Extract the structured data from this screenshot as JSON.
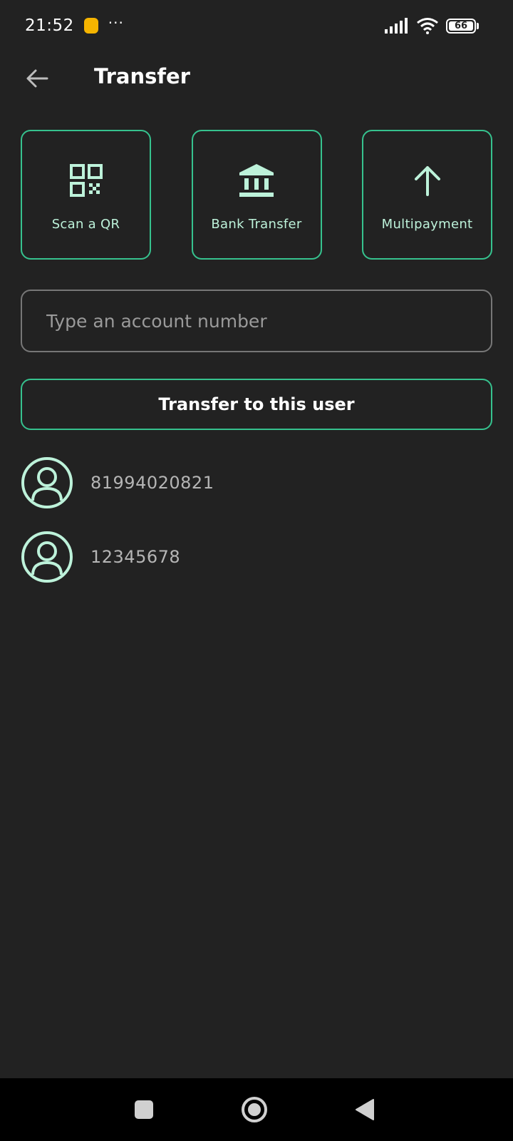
{
  "status_bar": {
    "time": "21:52",
    "battery": "66",
    "icons": [
      "notification-icon",
      "more-dots-icon",
      "signal-icon",
      "wifi-icon",
      "battery-icon"
    ]
  },
  "header": {
    "title": "Transfer",
    "back_icon": "arrow-left-icon"
  },
  "actions": [
    {
      "label": "Scan a QR",
      "icon": "qr-code-icon"
    },
    {
      "label": "Bank Transfer",
      "icon": "bank-icon"
    },
    {
      "label": "Multipayment",
      "icon": "arrow-up-icon"
    }
  ],
  "account_input": {
    "placeholder": "Type an account number",
    "value": ""
  },
  "transfer_button": {
    "label": "Transfer to this user"
  },
  "recent_accounts": [
    {
      "number": "81994020821",
      "icon": "user-avatar-icon"
    },
    {
      "number": "12345678",
      "icon": "user-avatar-icon"
    }
  ],
  "nav_bar": {
    "buttons": [
      "recents-square-icon",
      "home-circle-icon",
      "back-triangle-icon"
    ]
  },
  "colors": {
    "background": "#222222",
    "accent": "#36c28e",
    "icon_accent": "#bdf2da",
    "input_border": "#777777"
  }
}
